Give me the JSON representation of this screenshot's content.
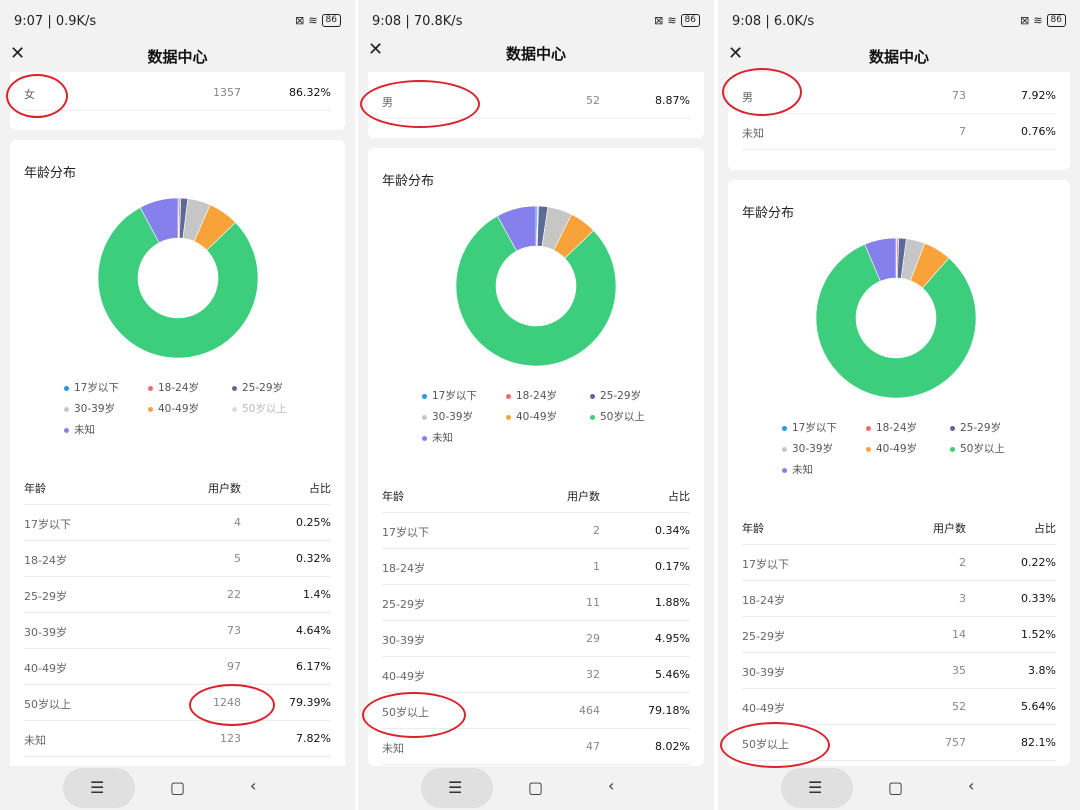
{
  "panels": [
    {
      "status_time": "9:07 | 0.9K/s",
      "battery": "86",
      "title": "数据中心",
      "gender_rows": [
        {
          "label": "女",
          "count": "1357",
          "pct": "86.32%"
        }
      ],
      "section_title": "年龄分布",
      "legend": [
        "17岁以下",
        "18-24岁",
        "25-29岁",
        "30-39岁",
        "40-49岁",
        "50岁以上",
        "未知"
      ],
      "table_headers": [
        "年龄",
        "用户数",
        "占比"
      ],
      "age_rows": [
        {
          "label": "17岁以下",
          "count": "4",
          "pct": "0.25%"
        },
        {
          "label": "18-24岁",
          "count": "5",
          "pct": "0.32%"
        },
        {
          "label": "25-29岁",
          "count": "22",
          "pct": "1.4%"
        },
        {
          "label": "30-39岁",
          "count": "73",
          "pct": "4.64%"
        },
        {
          "label": "40-49岁",
          "count": "97",
          "pct": "6.17%"
        },
        {
          "label": "50岁以上",
          "count": "1248",
          "pct": "79.39%"
        },
        {
          "label": "未知",
          "count": "123",
          "pct": "7.82%"
        }
      ]
    },
    {
      "status_time": "9:08 | 70.8K/s",
      "battery": "86",
      "title": "数据中心",
      "gender_rows": [
        {
          "label": "男",
          "count": "52",
          "pct": "8.87%"
        }
      ],
      "section_title": "年龄分布",
      "legend": [
        "17岁以下",
        "18-24岁",
        "25-29岁",
        "30-39岁",
        "40-49岁",
        "50岁以上",
        "未知"
      ],
      "table_headers": [
        "年龄",
        "用户数",
        "占比"
      ],
      "age_rows": [
        {
          "label": "17岁以下",
          "count": "2",
          "pct": "0.34%"
        },
        {
          "label": "18-24岁",
          "count": "1",
          "pct": "0.17%"
        },
        {
          "label": "25-29岁",
          "count": "11",
          "pct": "1.88%"
        },
        {
          "label": "30-39岁",
          "count": "29",
          "pct": "4.95%"
        },
        {
          "label": "40-49岁",
          "count": "32",
          "pct": "5.46%"
        },
        {
          "label": "50岁以上",
          "count": "464",
          "pct": "79.18%"
        },
        {
          "label": "未知",
          "count": "47",
          "pct": "8.02%"
        }
      ]
    },
    {
      "status_time": "9:08 | 6.0K/s",
      "battery": "86",
      "title": "数据中心",
      "gender_rows": [
        {
          "label": "男",
          "count": "73",
          "pct": "7.92%"
        },
        {
          "label": "未知",
          "count": "7",
          "pct": "0.76%"
        }
      ],
      "section_title": "年龄分布",
      "legend": [
        "17岁以下",
        "18-24岁",
        "25-29岁",
        "30-39岁",
        "40-49岁",
        "50岁以上",
        "未知"
      ],
      "table_headers": [
        "年龄",
        "用户数",
        "占比"
      ],
      "age_rows": [
        {
          "label": "17岁以下",
          "count": "2",
          "pct": "0.22%"
        },
        {
          "label": "18-24岁",
          "count": "3",
          "pct": "0.33%"
        },
        {
          "label": "25-29岁",
          "count": "14",
          "pct": "1.52%"
        },
        {
          "label": "30-39岁",
          "count": "35",
          "pct": "3.8%"
        },
        {
          "label": "40-49岁",
          "count": "52",
          "pct": "5.64%"
        },
        {
          "label": "50岁以上",
          "count": "757",
          "pct": "82.1%"
        }
      ]
    }
  ],
  "colors": {
    "under17": "#1e9be8",
    "18-24": "#ee6b73",
    "25-29": "#5b6b96",
    "30-39": "#c6c6c6",
    "40-49": "#f8a23a",
    "50plus": "#3cce7c",
    "unknown": "#8680ec",
    "highlight": "#d9232d"
  },
  "nav_icons": [
    "menu-icon",
    "home-square-icon",
    "back-chevron-icon"
  ],
  "chart_data": [
    {
      "type": "pie",
      "categories": [
        "17岁以下",
        "18-24岁",
        "25-29岁",
        "30-39岁",
        "40-49岁",
        "50岁以上",
        "未知"
      ],
      "values": [
        0.25,
        0.32,
        1.4,
        4.64,
        6.17,
        79.39,
        7.82
      ],
      "colors": [
        "#1e9be8",
        "#ee6b73",
        "#5b6b96",
        "#c6c6c6",
        "#f8a23a",
        "#3cce7c",
        "#8680ec"
      ],
      "legend": "bottom"
    },
    {
      "type": "pie",
      "categories": [
        "17岁以下",
        "18-24岁",
        "25-29岁",
        "30-39岁",
        "40-49岁",
        "50岁以上",
        "未知"
      ],
      "values": [
        0.34,
        0.17,
        1.88,
        4.95,
        5.46,
        79.18,
        8.02
      ],
      "colors": [
        "#1e9be8",
        "#ee6b73",
        "#5b6b96",
        "#c6c6c6",
        "#f8a23a",
        "#3cce7c",
        "#8680ec"
      ],
      "legend": "bottom"
    },
    {
      "type": "pie",
      "categories": [
        "17岁以下",
        "18-24岁",
        "25-29岁",
        "30-39岁",
        "40-49岁",
        "50岁以上",
        "未知"
      ],
      "values": [
        0.22,
        0.33,
        1.52,
        3.8,
        5.64,
        82.1,
        6.39
      ],
      "colors": [
        "#1e9be8",
        "#ee6b73",
        "#5b6b96",
        "#c6c6c6",
        "#f8a23a",
        "#3cce7c",
        "#8680ec"
      ],
      "legend": "bottom"
    }
  ]
}
